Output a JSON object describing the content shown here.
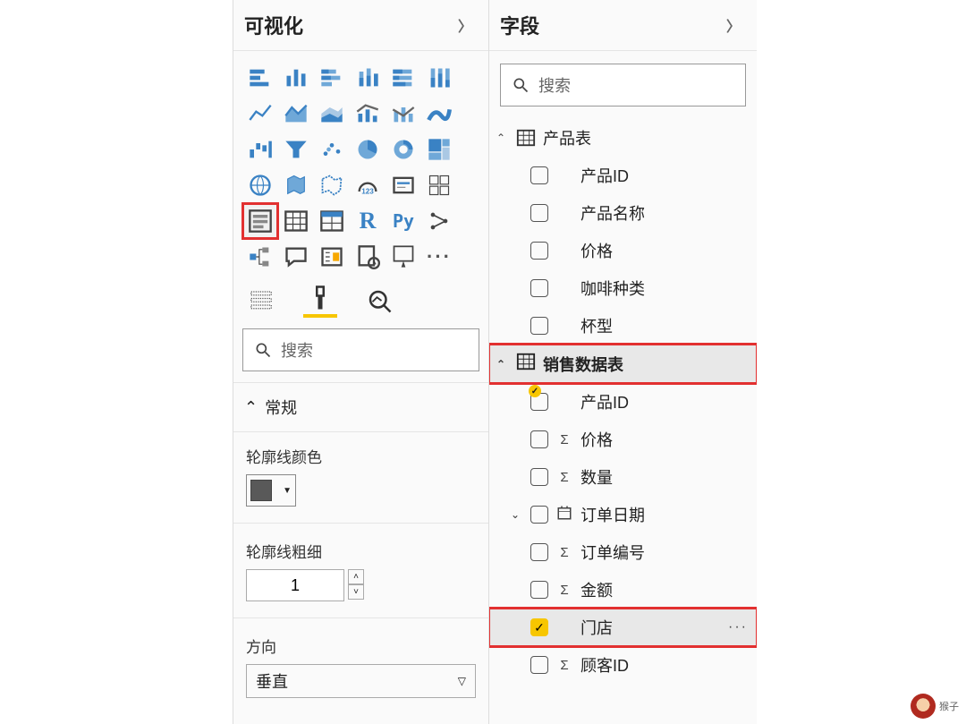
{
  "viz_pane": {
    "title": "可视化",
    "search_placeholder": "搜索",
    "general_section": "常规",
    "fmt": {
      "outline_color_label": "轮廓线颜色",
      "outline_weight_label": "轮廓线粗细",
      "outline_weight_value": "1",
      "direction_label": "方向",
      "direction_value": "垂直"
    },
    "highlighted_visual": "slicer"
  },
  "fields_pane": {
    "title": "字段",
    "search_placeholder": "搜索",
    "tables": [
      {
        "name": "产品表",
        "expanded": true,
        "active": false,
        "fields": [
          {
            "name": "产品ID",
            "checked": false,
            "type": "text"
          },
          {
            "name": "产品名称",
            "checked": false,
            "type": "text"
          },
          {
            "name": "价格",
            "checked": false,
            "type": "text"
          },
          {
            "name": "咖啡种类",
            "checked": false,
            "type": "text"
          },
          {
            "name": "杯型",
            "checked": false,
            "type": "text"
          }
        ]
      },
      {
        "name": "销售数据表",
        "expanded": true,
        "active": true,
        "fields": [
          {
            "name": "产品ID",
            "checked": false,
            "type": "text"
          },
          {
            "name": "价格",
            "checked": false,
            "type": "sum"
          },
          {
            "name": "数量",
            "checked": false,
            "type": "sum"
          },
          {
            "name": "订单日期",
            "checked": false,
            "type": "date"
          },
          {
            "name": "订单编号",
            "checked": false,
            "type": "sum"
          },
          {
            "name": "金额",
            "checked": false,
            "type": "sum"
          },
          {
            "name": "门店",
            "checked": true,
            "type": "text"
          },
          {
            "name": "顾客ID",
            "checked": false,
            "type": "sum"
          }
        ]
      }
    ]
  },
  "watermark": "猴子"
}
